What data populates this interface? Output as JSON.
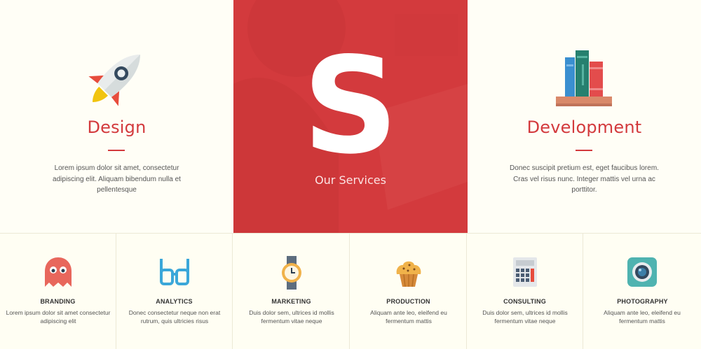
{
  "features": {
    "design": {
      "title": "Design",
      "text": "Lorem ipsum dolor sit amet, consectetur adipiscing elit. Aliquam bibendum nulla et pellentesque",
      "icon": "rocket-icon"
    },
    "services": {
      "letter": "S",
      "label": "Our Services"
    },
    "development": {
      "title": "Development",
      "text": "Donec suscipit pretium est, eget faucibus lorem. Cras vel risus nunc. Integer mattis vel urna ac porttitor.",
      "icon": "books-icon"
    }
  },
  "services": [
    {
      "title": "BRANDING",
      "text": "Lorem ipsum dolor sit amet consectetur adipiscing elit",
      "icon": "ghost-icon"
    },
    {
      "title": "ANALYTICS",
      "text": "Donec consectetur neque non erat rutrum, quis ultricies risus",
      "icon": "glasses-icon"
    },
    {
      "title": "MARKETING",
      "text": "Duis dolor sem, ultrices id mollis fermentum vitae neque",
      "icon": "watch-icon"
    },
    {
      "title": "PRODUCTION",
      "text": "Aliquam ante leo, eleifend eu fermentum mattis",
      "icon": "muffin-icon"
    },
    {
      "title": "CONSULTING",
      "text": "Duis dolor sem, ultrices id mollis fermentum vitae neque",
      "icon": "calculator-icon"
    },
    {
      "title": "PHOTOGRAPHY",
      "text": "Aliquam ante leo, eleifend eu fermentum mattis",
      "icon": "camera-icon"
    }
  ],
  "colors": {
    "accent": "#d33a3d",
    "background": "#fffef3"
  }
}
